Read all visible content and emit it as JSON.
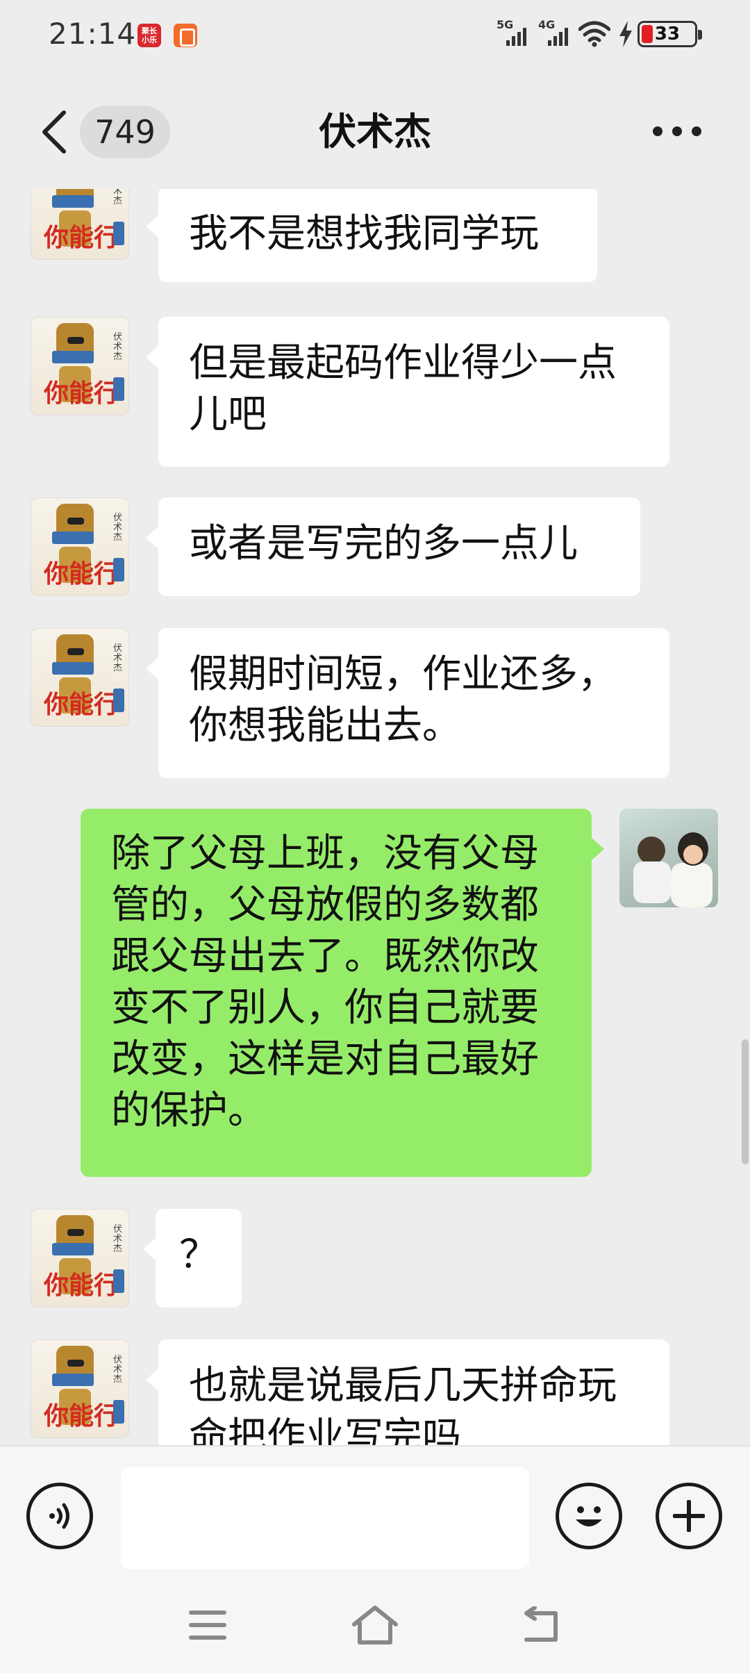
{
  "status_bar": {
    "time": "21:14",
    "notification_badge": "聚长小乐",
    "signal1_label": "5G",
    "signal2_label": "4G",
    "battery_level": "33",
    "battery_color": "#e02020"
  },
  "header": {
    "back_icon": "chevron-left-icon",
    "unread_count": "749",
    "title": "伏术杰",
    "more_icon": "more-horizontal-icon"
  },
  "robot_avatar": {
    "logo_text": "你能行",
    "side_text": "伏术杰"
  },
  "messages": [
    {
      "direction": "in",
      "text": "我不是想找我同学玩"
    },
    {
      "direction": "in",
      "text": "但是最起码作业得少一点儿吧"
    },
    {
      "direction": "in",
      "text": "或者是写完的多一点儿"
    },
    {
      "direction": "in",
      "text": "假期时间短，作业还多，你想我能出去。"
    },
    {
      "direction": "out",
      "text": "除了父母上班，没有父母管的，父母放假的多数都跟父母出去了。既然你改变不了别人，你自己就要改变，这样是对自己最好的保护。"
    },
    {
      "direction": "in",
      "text": "？"
    },
    {
      "direction": "in",
      "text": "也就是说最后几天拼命玩命把作业写完吗"
    }
  ],
  "input_bar": {
    "voice_icon": "voice-icon",
    "input_value": "",
    "emoji_icon": "emoji-icon",
    "plus_icon": "plus-icon"
  },
  "nav_bar": {
    "menu_icon": "menu-icon",
    "home_icon": "home-icon",
    "back_icon": "back-icon"
  },
  "colors": {
    "background": "#ededed",
    "bubble_in": "#ffffff",
    "bubble_out": "#95ec69"
  }
}
